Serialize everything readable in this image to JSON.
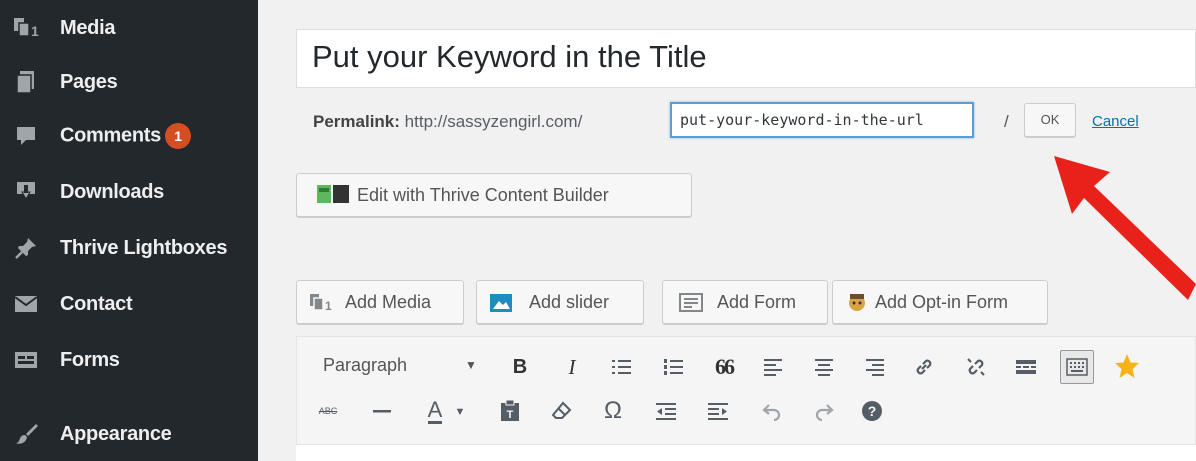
{
  "sidebar": {
    "items": [
      {
        "icon": "media-icon",
        "label": "Media"
      },
      {
        "icon": "pages-icon",
        "label": "Pages"
      },
      {
        "icon": "comments-icon",
        "label": "Comments",
        "badge": "1"
      },
      {
        "icon": "downloads-icon",
        "label": "Downloads"
      },
      {
        "icon": "pin-icon",
        "label": "Thrive Lightboxes"
      },
      {
        "icon": "envelope-icon",
        "label": "Contact"
      },
      {
        "icon": "forms-icon",
        "label": "Forms"
      },
      {
        "icon": "brush-icon",
        "label": "Appearance"
      }
    ]
  },
  "editor": {
    "title": "Put your Keyword in the Title",
    "permalink": {
      "label": "Permalink:",
      "base_url": "http://sassyzengirl.com/",
      "slug": "put-your-keyword-in-the-url",
      "slash": "/",
      "ok_label": "OK",
      "cancel_label": "Cancel"
    },
    "thrive_button": "Edit with Thrive Content Builder",
    "media_buttons": {
      "add_media": "Add Media",
      "add_slider": "Add slider",
      "add_form": "Add Form",
      "add_optin": "Add Opt-in Form"
    },
    "toolbar": {
      "format_select": "Paragraph",
      "bold": "B",
      "italic": "I",
      "quote": "66",
      "special_char": "Ω",
      "underline_letter": "A",
      "strike_label": "ABC"
    }
  },
  "colors": {
    "sidebar_bg": "#23282d",
    "badge": "#d54e21",
    "link": "#0073aa",
    "focus": "#5b9dd9",
    "annotation_arrow": "#e8221b"
  }
}
